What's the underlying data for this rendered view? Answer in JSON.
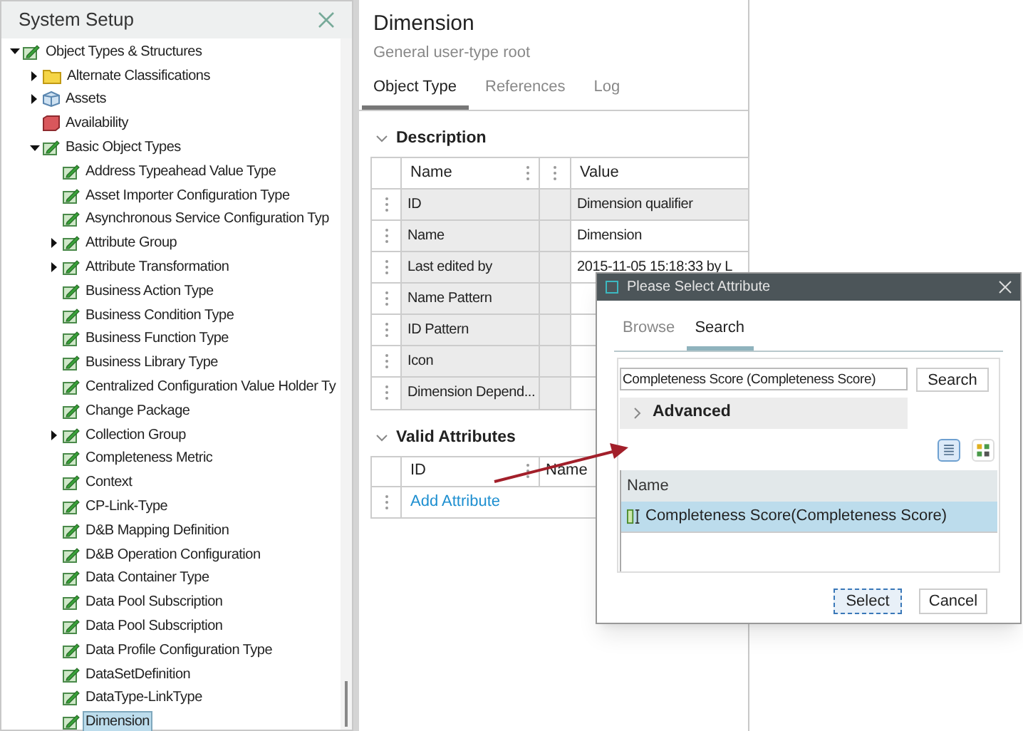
{
  "left_panel": {
    "title": "System Setup",
    "tree": [
      {
        "label": "Object Types & Structures",
        "kind": "type",
        "expanded": true,
        "selected": false,
        "children": [
          {
            "label": "Alternate Classifications",
            "kind": "folder",
            "expanded": false,
            "selected": false
          },
          {
            "label": "Assets",
            "kind": "asset",
            "expanded": false,
            "selected": false
          },
          {
            "label": "Availability",
            "kind": "cube",
            "selected": false
          },
          {
            "label": "Basic Object Types",
            "kind": "type",
            "expanded": true,
            "selected": false,
            "children": [
              {
                "label": "Address Typeahead Value Type",
                "kind": "type",
                "selected": false
              },
              {
                "label": "Asset Importer Configuration Type",
                "kind": "type",
                "selected": false
              },
              {
                "label": "Asynchronous Service Configuration Typ",
                "kind": "type",
                "selected": false
              },
              {
                "label": "Attribute Group",
                "kind": "type",
                "expanded": false,
                "selected": false
              },
              {
                "label": "Attribute Transformation",
                "kind": "type",
                "expanded": false,
                "selected": false
              },
              {
                "label": "Business Action Type",
                "kind": "type",
                "selected": false
              },
              {
                "label": "Business Condition Type",
                "kind": "type",
                "selected": false
              },
              {
                "label": "Business Function Type",
                "kind": "type",
                "selected": false
              },
              {
                "label": "Business Library Type",
                "kind": "type",
                "selected": false
              },
              {
                "label": "Centralized Configuration Value Holder Ty",
                "kind": "type",
                "selected": false
              },
              {
                "label": "Change Package",
                "kind": "type",
                "selected": false
              },
              {
                "label": "Collection Group",
                "kind": "type",
                "expanded": false,
                "selected": false
              },
              {
                "label": "Completeness Metric",
                "kind": "type",
                "selected": false
              },
              {
                "label": "Context",
                "kind": "type",
                "selected": false
              },
              {
                "label": "CP-Link-Type",
                "kind": "type",
                "selected": false
              },
              {
                "label": "D&B Mapping Definition",
                "kind": "type",
                "selected": false
              },
              {
                "label": "D&B Operation Configuration",
                "kind": "type",
                "selected": false
              },
              {
                "label": "Data Container Type",
                "kind": "type",
                "selected": false
              },
              {
                "label": "Data Pool Subscription",
                "kind": "type",
                "selected": false
              },
              {
                "label": "Data Pool Subscription",
                "kind": "type",
                "selected": false
              },
              {
                "label": "Data Profile Configuration Type",
                "kind": "type",
                "selected": false
              },
              {
                "label": "DataSetDefinition",
                "kind": "type",
                "selected": false
              },
              {
                "label": "DataType-LinkType",
                "kind": "type",
                "selected": false
              },
              {
                "label": "Dimension",
                "kind": "type",
                "selected": true
              }
            ]
          }
        ]
      }
    ]
  },
  "detail": {
    "title": "Dimension",
    "subtitle": "General user-type root",
    "tabs": [
      {
        "label": "Object Type",
        "selected": true
      },
      {
        "label": "References",
        "selected": false
      },
      {
        "label": "Log",
        "selected": false
      }
    ],
    "description": {
      "heading": "Description",
      "columns": [
        "Name",
        "Value"
      ],
      "rows": [
        {
          "name": "ID",
          "value": "Dimension qualifier",
          "read_only": true
        },
        {
          "name": "Name",
          "value": "Dimension",
          "read_only": false
        },
        {
          "name": "Last edited by",
          "value": "2015-11-05 15:18:33 by L",
          "read_only": false
        },
        {
          "name": "Name Pattern"
        },
        {
          "name": "ID Pattern"
        },
        {
          "name": "Icon"
        },
        {
          "name": "Dimension Depend..."
        }
      ]
    },
    "valid_attributes": {
      "heading": "Valid Attributes",
      "columns": [
        "ID",
        "Name"
      ],
      "link": "Add Attribute"
    }
  },
  "dialog": {
    "title": "Please Select Attribute",
    "tabs": [
      {
        "label": "Browse",
        "selected": false
      },
      {
        "label": "Search",
        "selected": true
      }
    ],
    "search_value": "Completeness Score (Completeness Score)",
    "search_button": "Search",
    "advanced": "Advanced",
    "views": [
      {
        "kind": "list",
        "selected": true
      },
      {
        "kind": "grid",
        "selected": false
      }
    ],
    "results": {
      "column": "Name",
      "rows": [
        {
          "label": "Completeness Score(Completeness Score)",
          "selected": true
        }
      ]
    },
    "buttons": [
      "Select",
      "Cancel"
    ]
  }
}
